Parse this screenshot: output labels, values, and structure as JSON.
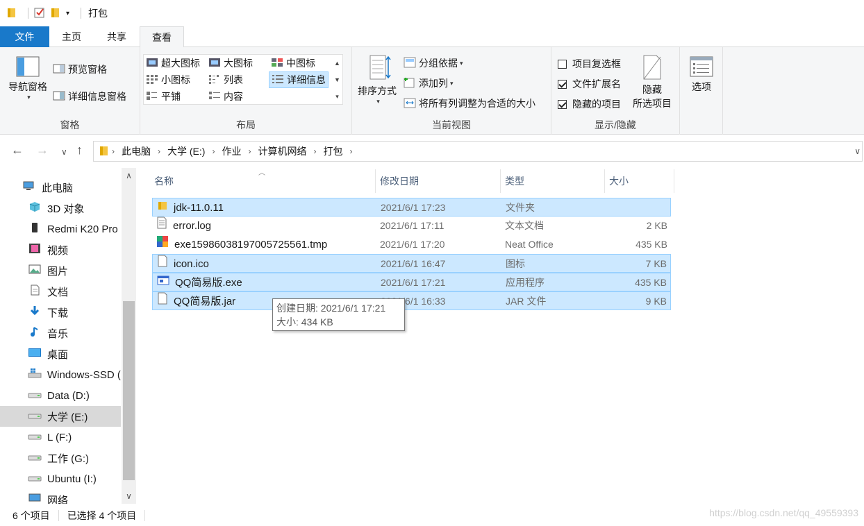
{
  "window": {
    "title": "打包"
  },
  "ribbon_tabs": [
    {
      "label": "文件"
    },
    {
      "label": "主页"
    },
    {
      "label": "共享"
    },
    {
      "label": "查看"
    }
  ],
  "ribbon": {
    "panes": {
      "label": "窗格",
      "nav_pane": "导航窗格",
      "preview_pane": "预览窗格",
      "details_pane": "详细信息窗格"
    },
    "layout": {
      "label": "布局",
      "extra_large": "超大图标",
      "large": "大图标",
      "medium": "中图标",
      "small": "小图标",
      "list": "列表",
      "details": "详细信息",
      "tiles": "平铺",
      "content": "内容"
    },
    "current_view": {
      "label": "当前视图",
      "sort_by": "排序方式",
      "group_by": "分组依据",
      "add_columns": "添加列",
      "size_all_columns": "将所有列调整为合适的大小"
    },
    "show_hide": {
      "label": "显示/隐藏",
      "item_checkboxes": "项目复选框",
      "item_checkboxes_checked": false,
      "file_extensions": "文件扩展名",
      "file_extensions_checked": true,
      "hidden_items": "隐藏的项目",
      "hidden_items_checked": true,
      "hide_selected_line1": "隐藏",
      "hide_selected_line2": "所选项目"
    },
    "options": {
      "label": "选项"
    }
  },
  "breadcrumb": [
    "此电脑",
    "大学 (E:)",
    "作业",
    "计算机网络",
    "打包"
  ],
  "sidebar": {
    "items": [
      {
        "label": "此电脑",
        "icon": "computer-icon"
      },
      {
        "label": "3D 对象",
        "icon": "cube-icon"
      },
      {
        "label": "Redmi K20 Pro",
        "icon": "phone-icon"
      },
      {
        "label": "视频",
        "icon": "video-icon"
      },
      {
        "label": "图片",
        "icon": "picture-icon"
      },
      {
        "label": "文档",
        "icon": "document-icon"
      },
      {
        "label": "下载",
        "icon": "download-icon"
      },
      {
        "label": "音乐",
        "icon": "music-icon"
      },
      {
        "label": "桌面",
        "icon": "desktop-icon"
      },
      {
        "label": "Windows-SSD (",
        "icon": "windows-drive-icon"
      },
      {
        "label": "Data (D:)",
        "icon": "drive-icon"
      },
      {
        "label": "大学 (E:)",
        "icon": "drive-icon",
        "selected": true
      },
      {
        "label": "L (F:)",
        "icon": "drive-icon"
      },
      {
        "label": "工作 (G:)",
        "icon": "drive-icon"
      },
      {
        "label": "Ubuntu (I:)",
        "icon": "drive-icon"
      },
      {
        "label": "网络",
        "icon": "network-icon"
      }
    ]
  },
  "columns": {
    "name": "名称",
    "date": "修改日期",
    "type": "类型",
    "size": "大小"
  },
  "files": [
    {
      "name": "jdk-11.0.11",
      "date": "2021/6/1 17:23",
      "type": "文件夹",
      "size": "",
      "icon": "folder-icon",
      "selected": true
    },
    {
      "name": "error.log",
      "date": "2021/6/1 17:11",
      "type": "文本文档",
      "size": "2 KB",
      "icon": "text-file-icon",
      "selected": false
    },
    {
      "name": "exe15986038197005725561.tmp",
      "date": "2021/6/1 17:20",
      "type": "Neat Office",
      "size": "435 KB",
      "icon": "office-file-icon",
      "selected": false
    },
    {
      "name": "icon.ico",
      "date": "2021/6/1 16:47",
      "type": "图标",
      "size": "7 KB",
      "icon": "file-icon",
      "selected": true
    },
    {
      "name": "QQ简易版.exe",
      "date": "2021/6/1 17:21",
      "type": "应用程序",
      "size": "435 KB",
      "icon": "app-icon",
      "selected": true
    },
    {
      "name": "QQ简易版.jar",
      "date": "2021/6/1 16:33",
      "type": "JAR 文件",
      "size": "9 KB",
      "icon": "file-icon",
      "selected": true
    }
  ],
  "tooltip": {
    "line1": "创建日期: 2021/6/1 17:21",
    "line2": "大小: 434 KB"
  },
  "status": {
    "count": "6 个项目",
    "selected": "已选择 4 个项目"
  },
  "watermark": "https://blog.csdn.net/qq_49559393",
  "colors": {
    "accent": "#1979ca",
    "selection": "#cce8ff",
    "selection_border": "#99d1ff"
  }
}
